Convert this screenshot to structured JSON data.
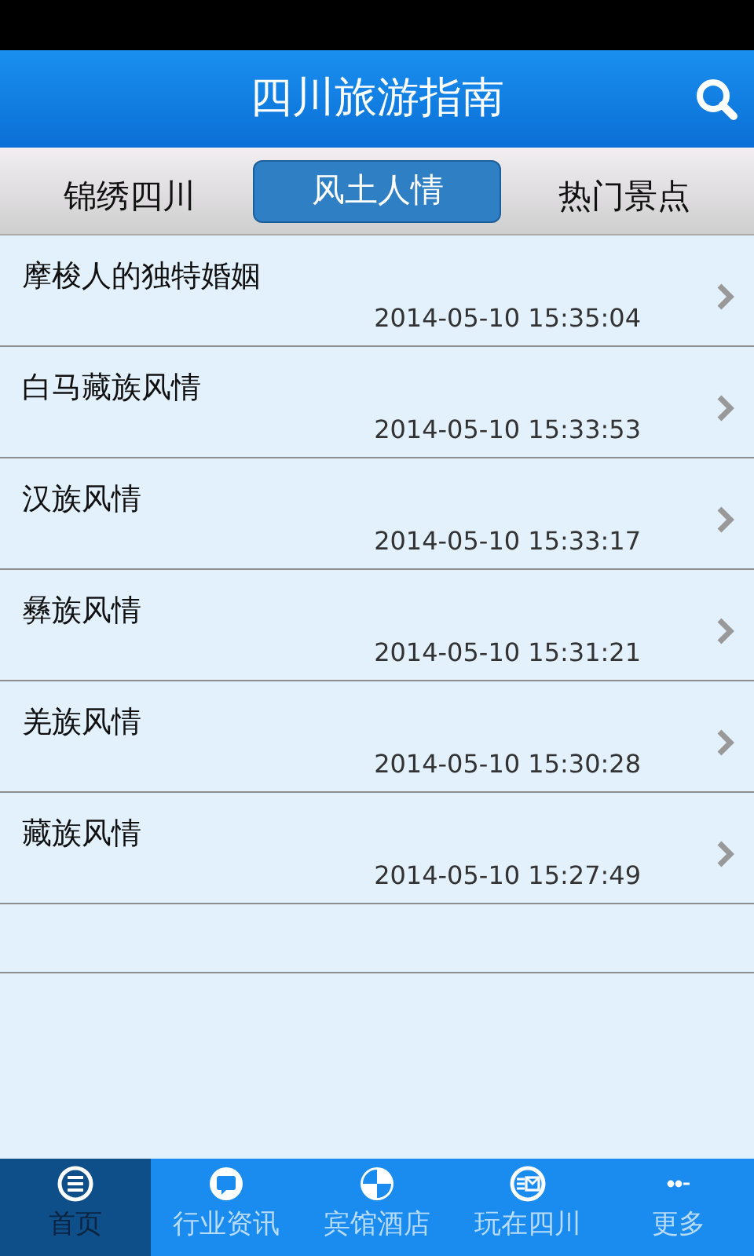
{
  "header": {
    "title": "四川旅游指南"
  },
  "tabs": [
    {
      "label": "锦绣四川",
      "selected": false
    },
    {
      "label": "风土人情",
      "selected": true
    },
    {
      "label": "热门景点",
      "selected": false
    }
  ],
  "articles": [
    {
      "title": "摩梭人的独特婚姻",
      "date": "2014-05-10 15:35:04"
    },
    {
      "title": "白马藏族风情",
      "date": "2014-05-10 15:33:53"
    },
    {
      "title": "汉族风情",
      "date": "2014-05-10 15:33:17"
    },
    {
      "title": "彝族风情",
      "date": "2014-05-10 15:31:21"
    },
    {
      "title": "羌族风情",
      "date": "2014-05-10 15:30:28"
    },
    {
      "title": "藏族风情",
      "date": "2014-05-10 15:27:49"
    }
  ],
  "bottom_nav": [
    {
      "label": "首页",
      "kind": "list",
      "selected": true
    },
    {
      "label": "行业资讯",
      "kind": "chat",
      "selected": false
    },
    {
      "label": "宾馆酒店",
      "kind": "quadrant",
      "selected": false
    },
    {
      "label": "玩在四川",
      "kind": "mail",
      "selected": false
    },
    {
      "label": "更多",
      "kind": "dots",
      "selected": false
    }
  ]
}
